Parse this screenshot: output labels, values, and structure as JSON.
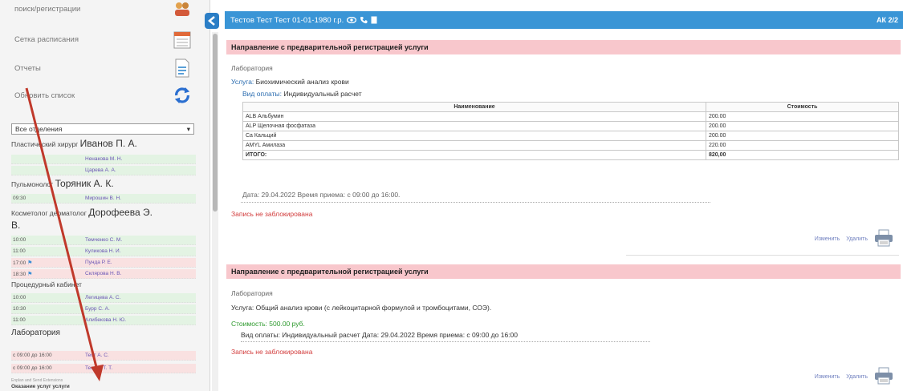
{
  "sidebar": {
    "menu": [
      {
        "label": "поиск/регистрации",
        "icon": "users-icon"
      },
      {
        "label": "Сетка расписания",
        "icon": "schedule-grid-icon"
      },
      {
        "label": "Отчеты",
        "icon": "report-icon"
      },
      {
        "label": "Обновить список",
        "icon": "refresh-icon"
      }
    ],
    "department_select": "Все отделения",
    "doctors": [
      {
        "role": "Пластический хирург",
        "name": "Иванов П. А.",
        "slots": [
          {
            "time": "",
            "patient": "Ненакова М. Н."
          },
          {
            "time": "",
            "patient": "Царева А. А."
          }
        ]
      },
      {
        "role": "Пульмонолог",
        "name": "Торяник А. К.",
        "slots": [
          {
            "time": "09:30",
            "patient": "Мирошин В. Н."
          }
        ]
      },
      {
        "role": "Косметолог дерматолог",
        "name": "Дорофеева Э.",
        "name2": "В.",
        "slots": [
          {
            "time": "10:00",
            "patient": "Темченко С. М."
          },
          {
            "time": "11:00",
            "patient": "Куликова Н. И."
          },
          {
            "time": "17:00",
            "patient": "Пунда Р. Е."
          },
          {
            "time": "18:30",
            "patient": "Склярова Н. В."
          }
        ]
      },
      {
        "role": "Процедурный кабинет",
        "name": "",
        "slots": [
          {
            "time": "10:00",
            "patient": "Легицева А. С."
          },
          {
            "time": "10:30",
            "patient": "Бурр С. А."
          },
          {
            "time": "11:00",
            "patient": "Алибекова Н. Ю."
          }
        ]
      },
      {
        "role": "",
        "name": "Лаборатория",
        "slots": [
          {
            "time": "с 09:00 до 16:00",
            "patient": "Тест А. С."
          },
          {
            "time": "с 09:00 до 16:00",
            "patient": "Тестов Т. Т."
          }
        ]
      }
    ],
    "footer_small": "Enplan and Send Extensions",
    "footer_bold": "Оказание услуг услуги"
  },
  "patient_bar": {
    "title": "Тестов Тест Тест 01-01-1980 г.р.",
    "right": "АК 2/2"
  },
  "referral1": {
    "header": "Направление с предварительной регистрацией услуги",
    "department": "Лаборатория",
    "service_label": "Услуга:",
    "service": "Биохимический анализ крови",
    "payment_label": "Вид оплаты:",
    "payment": "Индивидуальный расчет",
    "table": {
      "columns": [
        "Наименование",
        "Стоимость"
      ],
      "rows": [
        [
          "ALB Альбумин",
          "200.00"
        ],
        [
          "ALP Щелочная фосфатаза",
          "200.00"
        ],
        [
          "Ca Кальций",
          "200.00"
        ],
        [
          "AMYL Амилаза",
          "220.00"
        ]
      ],
      "total": [
        "ИТОГО:",
        "820,00"
      ]
    },
    "date_line": "Дата: 29.04.2022 Время приема: с 09:00 до 16:00.",
    "status": "Запись не заблокирована",
    "edit": "Изменить",
    "delete": "Удалить"
  },
  "referral2": {
    "header": "Направление с предварительной регистрацией услуги",
    "department": "Лаборатория",
    "service_line": "Услуга: Общий анализ крови (с лейкоцитарной формулой и тромбоцитами, СОЭ).",
    "cost_line": "Стоимость: 500.00 руб.",
    "payment_line": "Вид оплаты: Индивидуальный расчет Дата: 29.04.2022 Время приема: с 09:00 до 16:00",
    "status": "Запись не заблокирована",
    "edit": "Изменить",
    "delete": "Удалить"
  },
  "colors": {
    "accent": "#3a95d6",
    "header_pink": "#f8c7cc",
    "annotation_arrow": "#c0392b"
  }
}
